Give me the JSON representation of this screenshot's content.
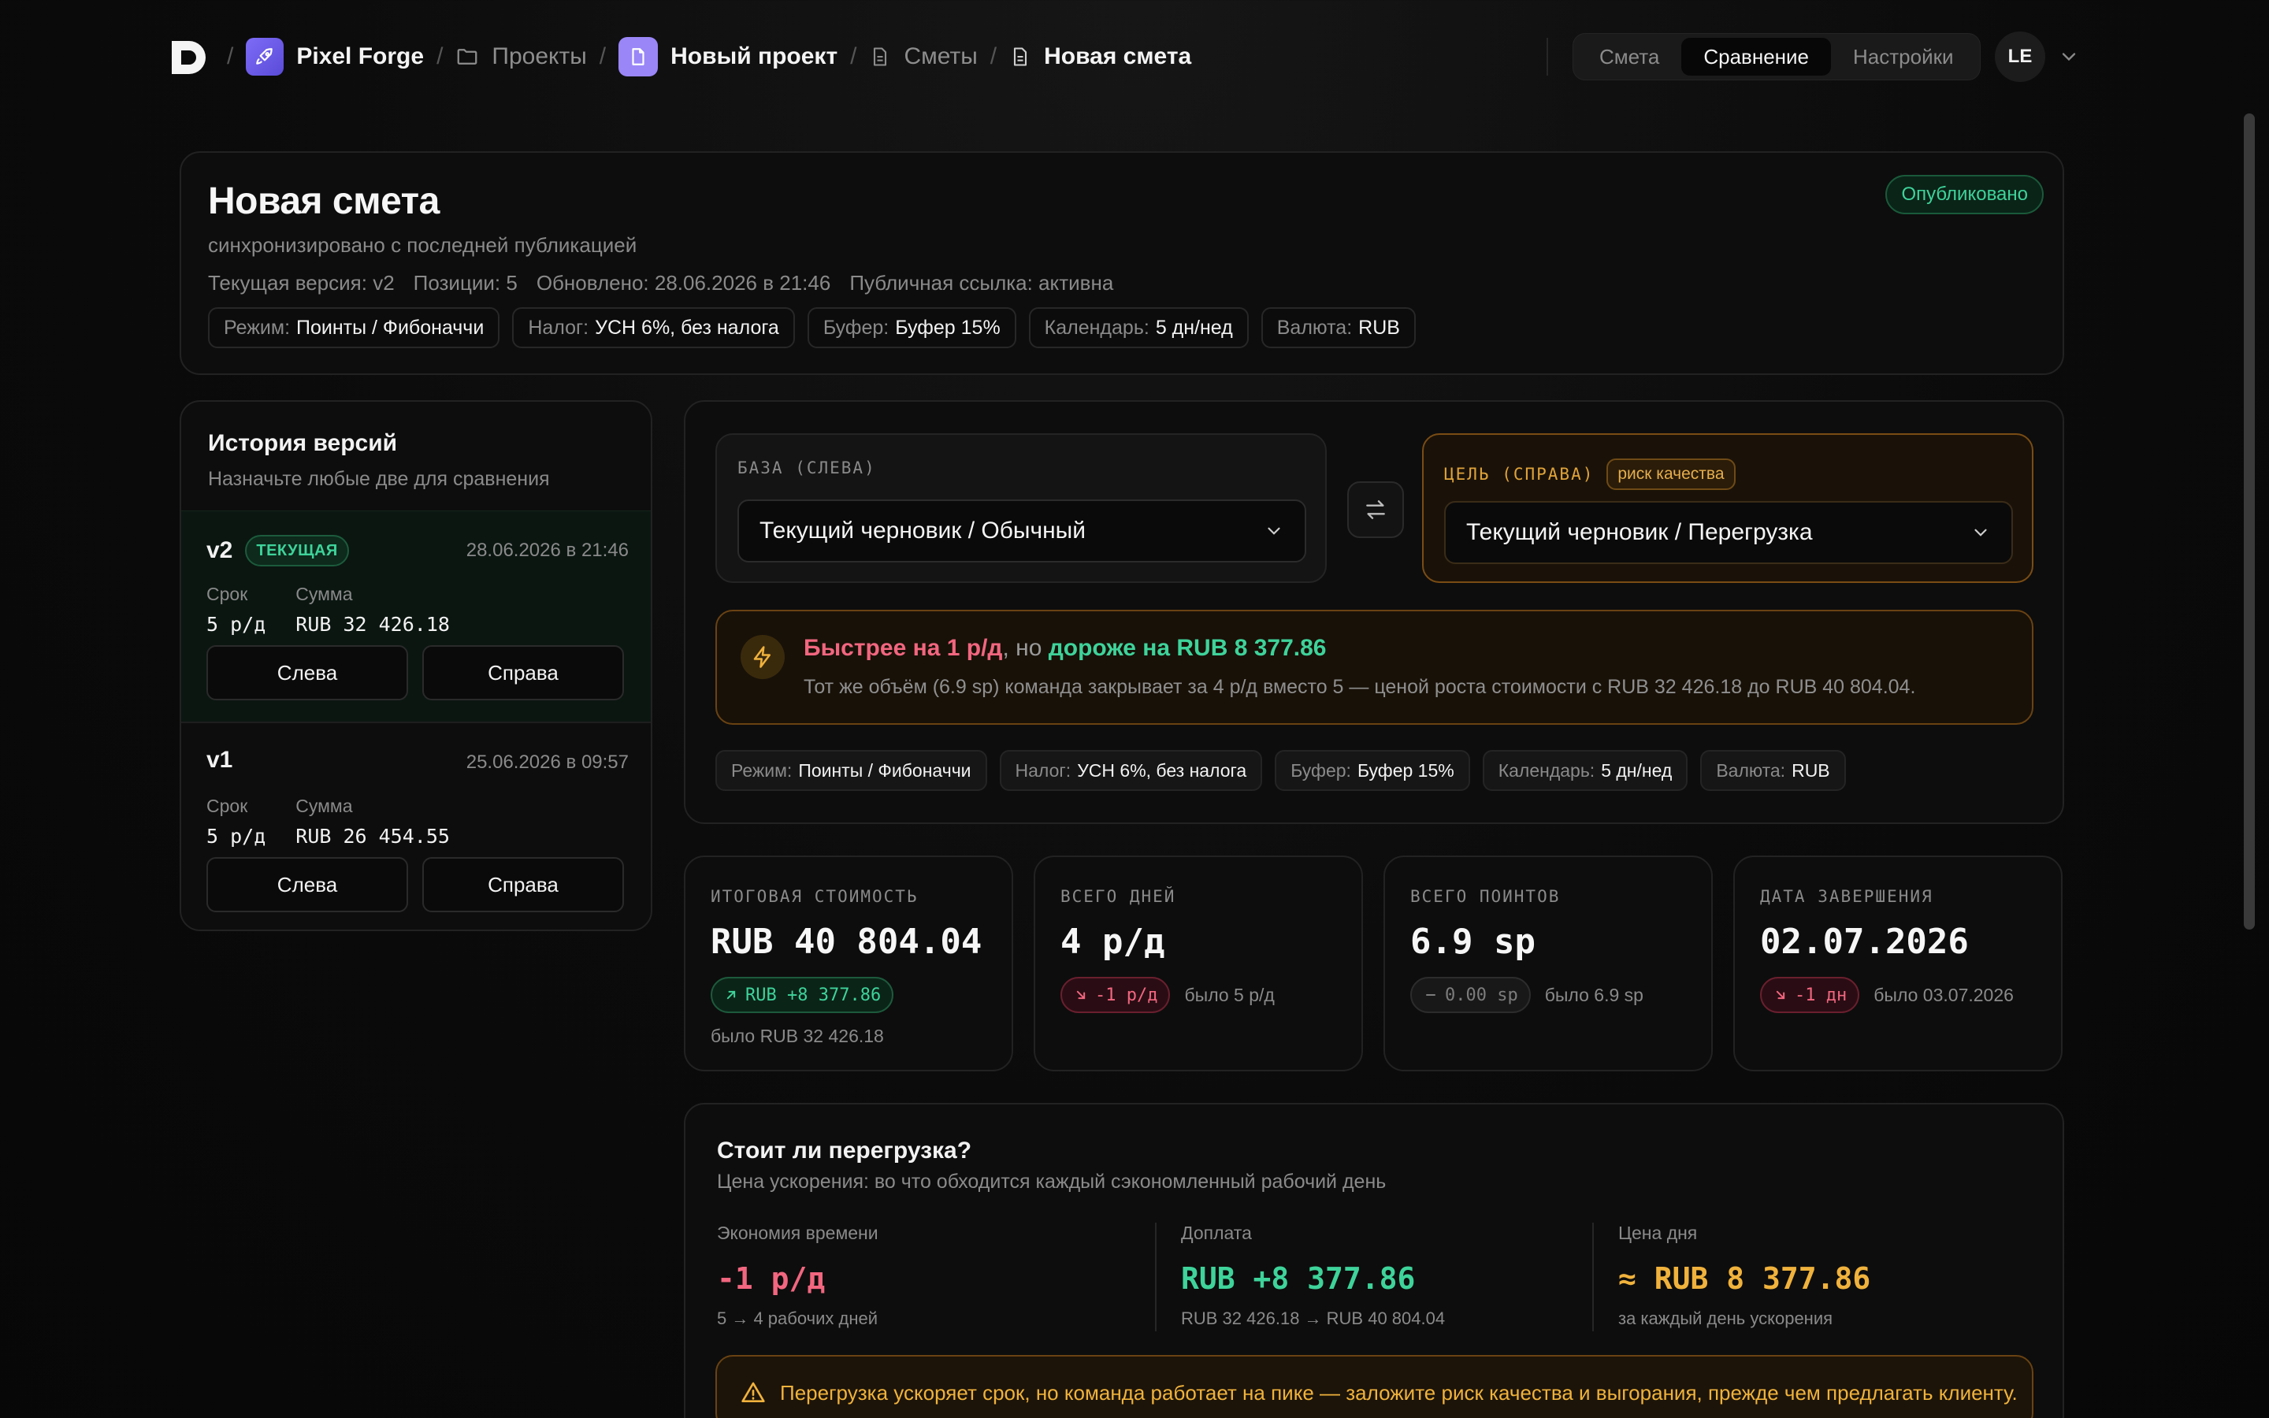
{
  "breadcrumbs": {
    "workspace": "Pixel Forge",
    "projects": "Проекты",
    "project": "Новый проект",
    "estimates": "Сметы",
    "current": "Новая смета"
  },
  "view_tabs": [
    {
      "label": "Смета",
      "active": false
    },
    {
      "label": "Сравнение",
      "active": true
    },
    {
      "label": "Настройки",
      "active": false
    }
  ],
  "user": {
    "initials": "LE"
  },
  "header": {
    "title": "Новая смета",
    "subtitle": "синхронизировано с последней публикацией",
    "status": "Опубликовано",
    "meta": [
      "Текущая версия: v2",
      "Позиции: 5",
      "Обновлено: 28.06.2026 в 21:46",
      "Публичная ссылка: активна"
    ],
    "chips": [
      {
        "key": "Режим:",
        "value": "Поинты / Фибоначчи"
      },
      {
        "key": "Налог:",
        "value": "УСН 6%, без налога"
      },
      {
        "key": "Буфер:",
        "value": "Буфер 15%"
      },
      {
        "key": "Календарь:",
        "value": "5 дн/нед"
      },
      {
        "key": "Валюта:",
        "value": "RUB"
      }
    ]
  },
  "history": {
    "title": "История версий",
    "subtitle": "Назначьте любые две для сравнения",
    "col_term": "Срок",
    "col_sum": "Сумма",
    "btn_left": "Слева",
    "btn_right": "Справа",
    "versions": [
      {
        "name": "v2",
        "badge": "ТЕКУЩАЯ",
        "date": "28.06.2026 в 21:46",
        "term": "5 р/д",
        "sum": "RUB 32 426.18"
      },
      {
        "name": "v1",
        "badge": "",
        "date": "25.06.2026 в 09:57",
        "term": "5 р/д",
        "sum": "RUB 26 454.55"
      }
    ]
  },
  "compare": {
    "base_label": "БАЗА (СЛЕВА)",
    "base_value": "Текущий черновик / Обычный",
    "target_label": "ЦЕЛЬ (СПРАВА)",
    "target_badge": "риск качества",
    "target_value": "Текущий черновик / Перегрузка",
    "insight": {
      "faster": "Быстрее на 1 р/д",
      "joiner": ", но",
      "pricier": "дороже на RUB 8 377.86",
      "text": "Тот же объём (6.9 sp) команда закрывает за 4 р/д вместо 5 — ценой роста стоимости с RUB 32 426.18 до RUB 40 804.04."
    },
    "chips": [
      {
        "key": "Режим:",
        "value": "Поинты / Фибоначчи"
      },
      {
        "key": "Налог:",
        "value": "УСН 6%, без налога"
      },
      {
        "key": "Буфер:",
        "value": "Буфер 15%"
      },
      {
        "key": "Календарь:",
        "value": "5 дн/нед"
      },
      {
        "key": "Валюта:",
        "value": "RUB"
      }
    ]
  },
  "metrics": [
    {
      "label": "ИТОГОВАЯ СТОИМОСТЬ",
      "value": "RUB 40 804.04",
      "delta": "RUB +8 377.86",
      "trend": "up",
      "was": "было RUB 32 426.18"
    },
    {
      "label": "ВСЕГО ДНЕЙ",
      "value": "4 р/д",
      "delta": "-1 р/д",
      "trend": "down",
      "was": "было 5 р/д"
    },
    {
      "label": "ВСЕГО ПОИНТОВ",
      "value": "6.9 sp",
      "delta": "0.00 sp",
      "trend": "neutral",
      "was": "было 6.9 sp"
    },
    {
      "label": "ДАТА ЗАВЕРШЕНИЯ",
      "value": "02.07.2026",
      "delta": "-1 дн",
      "trend": "down",
      "was": "было 03.07.2026"
    }
  ],
  "overload": {
    "title": "Стоит ли перегрузка?",
    "subtitle": "Цена ускорения: во что обходится каждый сэкономленный рабочий день",
    "time_label": "Экономия времени",
    "time_value": "-1 р/д",
    "time_note": "5 → 4 рабочих дней",
    "extra_label": "Доплата",
    "extra_value": "RUB +8 377.86",
    "extra_note": "RUB 32 426.18 → RUB 40 804.04",
    "day_label": "Цена дня",
    "day_value": "≈ RUB 8 377.86",
    "day_note": "за каждый день ускорения",
    "warning": "Перегрузка ускоряет срок, но команда работает на пике — заложите риск качества и выгорания, прежде чем предлагать клиенту."
  },
  "colors": {
    "accent_green": "#3ed39a",
    "accent_red": "#f2667f",
    "accent_amber": "#f0b23c",
    "brand_purple": "#7d6cf6"
  }
}
